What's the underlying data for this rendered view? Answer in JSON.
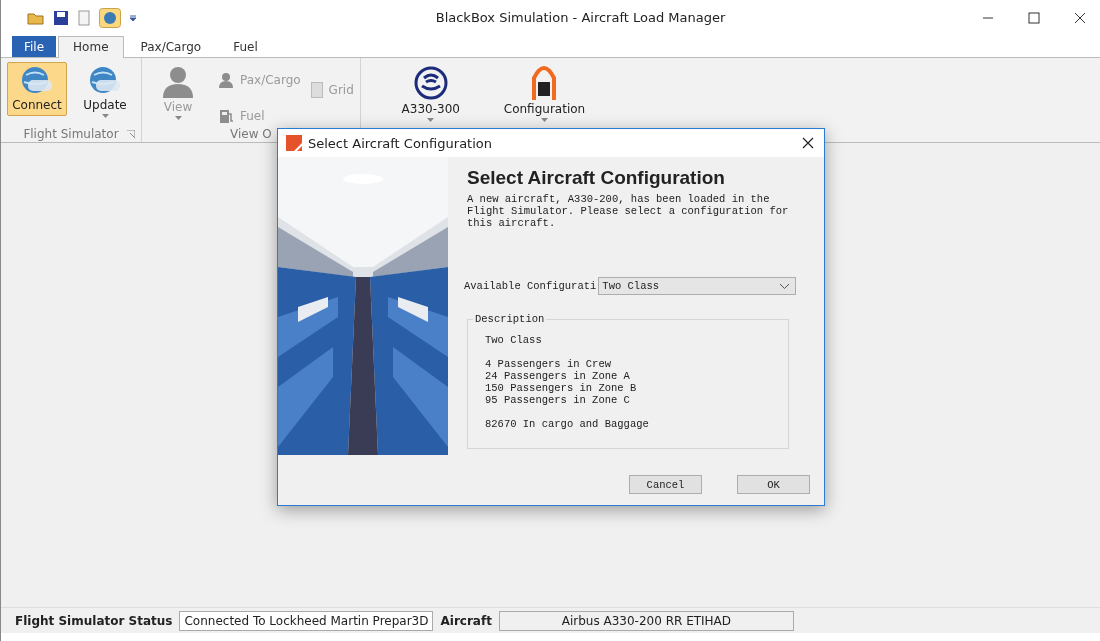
{
  "window": {
    "title": "BlackBox Simulation - Aircraft Load Manager"
  },
  "tabs": [
    {
      "label": "File",
      "kind": "file",
      "selected": false
    },
    {
      "label": "Home",
      "kind": "tab",
      "selected": true
    },
    {
      "label": "Pax/Cargo",
      "kind": "tab",
      "selected": false
    },
    {
      "label": "Fuel",
      "kind": "tab",
      "selected": false
    }
  ],
  "ribbon_groups": [
    {
      "label": "Flight Simulator",
      "launcher": true,
      "buttons": [
        {
          "label": "Connect",
          "kind": "large",
          "selected": true,
          "disabled": false,
          "dropdown": false
        },
        {
          "label": "Update",
          "kind": "large",
          "selected": false,
          "disabled": false,
          "dropdown": true
        }
      ]
    },
    {
      "label": "View O",
      "buttons": [
        {
          "label": "View",
          "kind": "large",
          "selected": false,
          "disabled": true,
          "dropdown": true
        },
        {
          "label": "Pax/Cargo",
          "kind": "small",
          "disabled": true
        },
        {
          "label": "Fuel",
          "kind": "small",
          "disabled": true
        },
        {
          "label": "Grid",
          "kind": "check",
          "checked": false,
          "disabled": true
        }
      ]
    },
    {
      "buttons": [
        {
          "label": "A330-300",
          "kind": "large",
          "selected": false,
          "disabled": false,
          "dropdown": true
        },
        {
          "label": "Configuration",
          "kind": "large",
          "selected": false,
          "disabled": false,
          "dropdown": true
        }
      ]
    }
  ],
  "dialog": {
    "title": "Select Aircraft Configuration",
    "heading": "Select Aircraft Configuration",
    "message": "A new aircraft, A330-200, has been loaded in the Flight Simulator. Please select a configuration for this aircraft.",
    "field_label": "Available Configurati",
    "select_value": "Two Class",
    "description_legend": "Description",
    "description_paragraphs": [
      {
        "lines": [
          "Two Class"
        ]
      },
      {
        "lines": [
          "4 Passengers in Crew",
          "24 Passengers in Zone A",
          "150 Passengers in Zone B",
          "95 Passengers in Zone C"
        ]
      },
      {
        "lines": [
          "82670 In cargo and Baggage"
        ]
      }
    ],
    "buttons": [
      "Cancel",
      "OK"
    ]
  },
  "status_bar": [
    {
      "label": "Flight Simulator Status",
      "kind": "label"
    },
    {
      "label": "Connected To Lockheed Martin Prepar3D",
      "kind": "value"
    },
    {
      "label": "Aircraft",
      "kind": "label"
    },
    {
      "label": "Airbus A330-200 RR ETIHAD",
      "kind": "wide"
    }
  ]
}
